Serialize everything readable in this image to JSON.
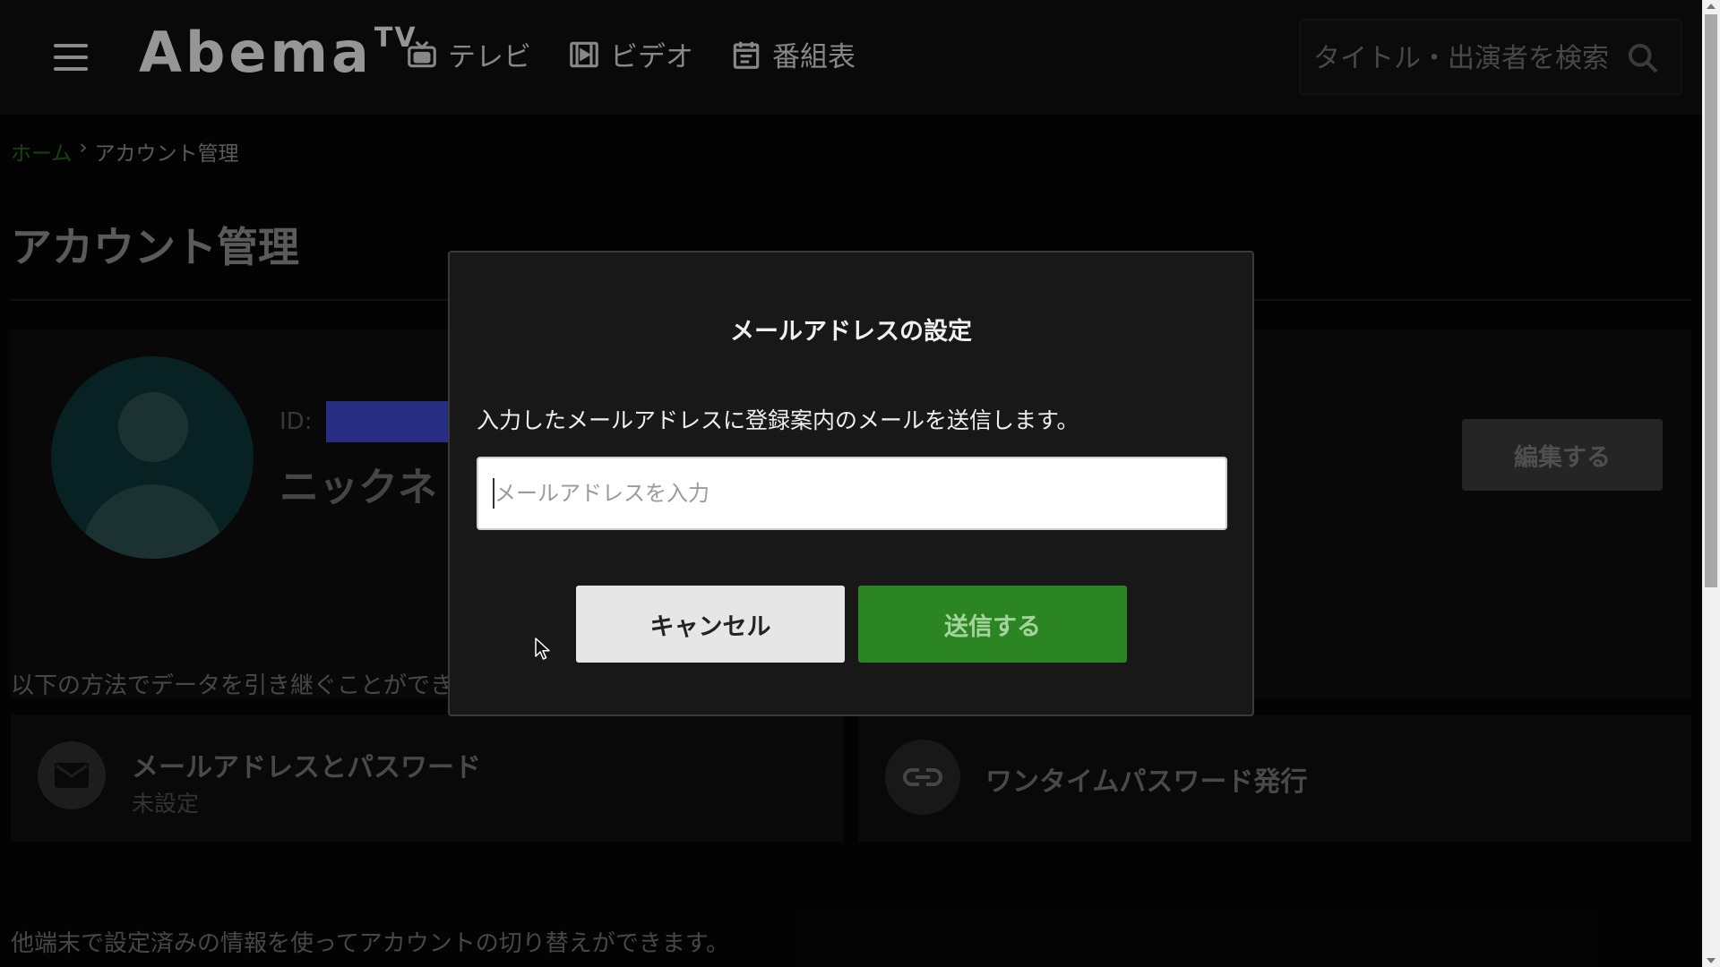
{
  "header": {
    "logo": "Abema",
    "logo_tv": "TV",
    "nav": [
      {
        "label": "テレビ",
        "icon": "tv-icon"
      },
      {
        "label": "ビデオ",
        "icon": "video-icon"
      },
      {
        "label": "番組表",
        "icon": "calendar-icon"
      }
    ],
    "search_placeholder": "タイトル・出演者を検索"
  },
  "breadcrumb": {
    "home": "ホーム",
    "separator": "›",
    "current": "アカウント管理"
  },
  "page": {
    "title": "アカウント管理",
    "id_label": "ID:",
    "nickname": "ニックネ",
    "edit_button": "編集する",
    "inherit_text": "以下の方法でデータを引き継ぐことができ",
    "methods": [
      {
        "title": "メールアドレスとパスワード",
        "status": "未設定",
        "icon": "mail-icon"
      },
      {
        "title": "ワンタイムパスワード発行",
        "icon": "link-icon"
      }
    ],
    "switch_text": "他端末で設定済みの情報を使ってアカウントの切り替えができます。"
  },
  "modal": {
    "title": "メールアドレスの設定",
    "description": "入力したメールアドレスに登録案内のメールを送信します。",
    "input_placeholder": "メールアドレスを入力",
    "cancel_label": "キャンセル",
    "send_label": "送信する"
  },
  "colors": {
    "send_button": "#2c8523",
    "breadcrumb_home": "#1f6b12",
    "id_redaction": "#3c46c8"
  }
}
